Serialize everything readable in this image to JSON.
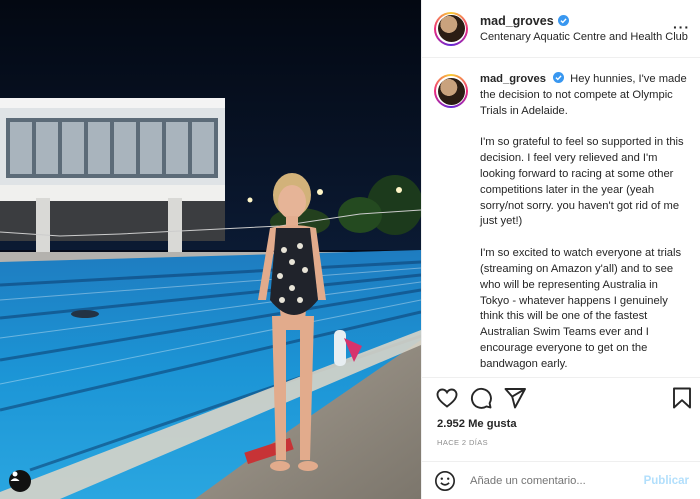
{
  "post": {
    "username": "mad_groves",
    "location": "Centenary Aquatic Centre and Health Club",
    "caption": {
      "p1": "Hey hunnies, I've made the decision to not compete at Olympic Trials in Adelaide.",
      "p2": "I'm so grateful to feel so supported in this decision. I feel very relieved and I'm looking forward to racing at some other competitions later in the year (yeah sorry/not sorry. you haven't got rid of me just yet!)",
      "p3": "I'm so excited to watch everyone at trials (streaming on Amazon y'all) and to see who will be representing Australia in Tokyo - whatever happens I genuinely think this will be one of the fastest Australian Swim Teams ever and I encourage everyone to get on the bandwagon early."
    },
    "likes": "2.952 Me gusta",
    "time": "HACE 2 DÍAS"
  },
  "comment": {
    "placeholder": "Añade un comentario...",
    "post_label": "Publicar"
  },
  "icons": {
    "more": "more-options-icon",
    "like": "heart-icon",
    "comment": "comment-icon",
    "share": "paper-plane-icon",
    "save": "bookmark-icon",
    "emoji": "emoji-icon",
    "user_tag": "user-tag-icon",
    "verified": "verified-badge-icon"
  },
  "colors": {
    "verified_blue": "#3897f0",
    "post_button": "#b2dffc",
    "muted_text": "#8e8e8e"
  }
}
